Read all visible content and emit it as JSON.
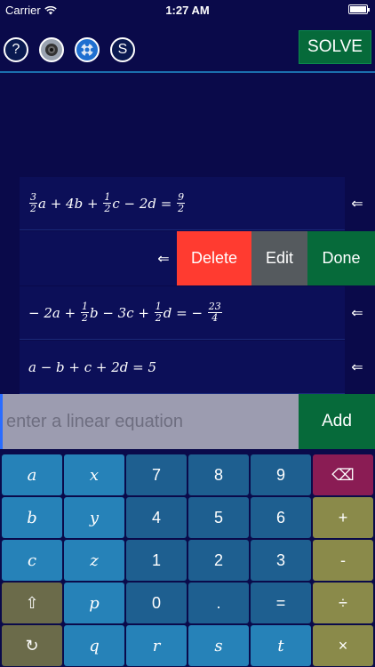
{
  "status_bar": {
    "carrier": "Carrier",
    "time": "1:27 AM"
  },
  "toolbar": {
    "help_label": "?",
    "s_label": "S",
    "solve_label": "SOLVE"
  },
  "equations": {
    "row1": {
      "coef_a_num": "3",
      "coef_a_den": "2",
      "t1": "a + 4b +",
      "coef_c_num": "1",
      "coef_c_den": "2",
      "t2": "c − 2d =",
      "rhs_num": "9",
      "rhs_den": "2"
    },
    "row3": {
      "t0": "− 2a +",
      "b_num": "1",
      "b_den": "2",
      "t1": "b − 3c +",
      "d_num": "1",
      "d_den": "2",
      "t2": "d = −",
      "rhs_num": "23",
      "rhs_den": "4"
    },
    "row4": {
      "text": "a − b + c + 2d = 5"
    },
    "arrow": "⇐"
  },
  "swipe_actions": {
    "delete": "Delete",
    "edit": "Edit",
    "done": "Done"
  },
  "input": {
    "placeholder": "enter a linear equation",
    "value": "",
    "add_label": "Add"
  },
  "keyboard": {
    "rows": [
      [
        "a",
        "x",
        "7",
        "8",
        "9",
        "⌫"
      ],
      [
        "b",
        "y",
        "4",
        "5",
        "6",
        "+"
      ],
      [
        "c",
        "z",
        "1",
        "2",
        "3",
        "-"
      ],
      [
        "⇧",
        "p",
        "0",
        ".",
        "=",
        "÷"
      ],
      [
        "↻",
        "q",
        "r",
        "s",
        "t",
        "×"
      ]
    ]
  },
  "colors": {
    "background": "#0a0a4a",
    "accent_green": "#066a3a",
    "delete_red": "#ff3b30"
  }
}
